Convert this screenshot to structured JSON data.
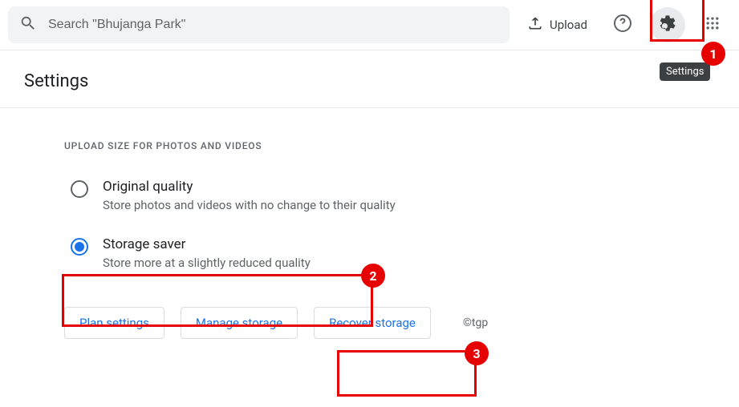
{
  "header": {
    "search_placeholder": "Search \"Bhujanga Park\"",
    "upload_label": "Upload",
    "settings_tooltip": "Settings"
  },
  "page": {
    "title": "Settings",
    "section_label": "UPLOAD SIZE FOR PHOTOS AND VIDEOS"
  },
  "options": {
    "original": {
      "title": "Original quality",
      "desc": "Store photos and videos with no change to their quality"
    },
    "saver": {
      "title": "Storage saver",
      "desc": "Store more at a slightly reduced quality"
    }
  },
  "buttons": {
    "plan": "Plan settings",
    "manage": "Manage storage",
    "recover": "Recover storage"
  },
  "footer": {
    "copyright": "©tgp"
  },
  "annotations": {
    "b1": "1",
    "b2": "2",
    "b3": "3"
  }
}
